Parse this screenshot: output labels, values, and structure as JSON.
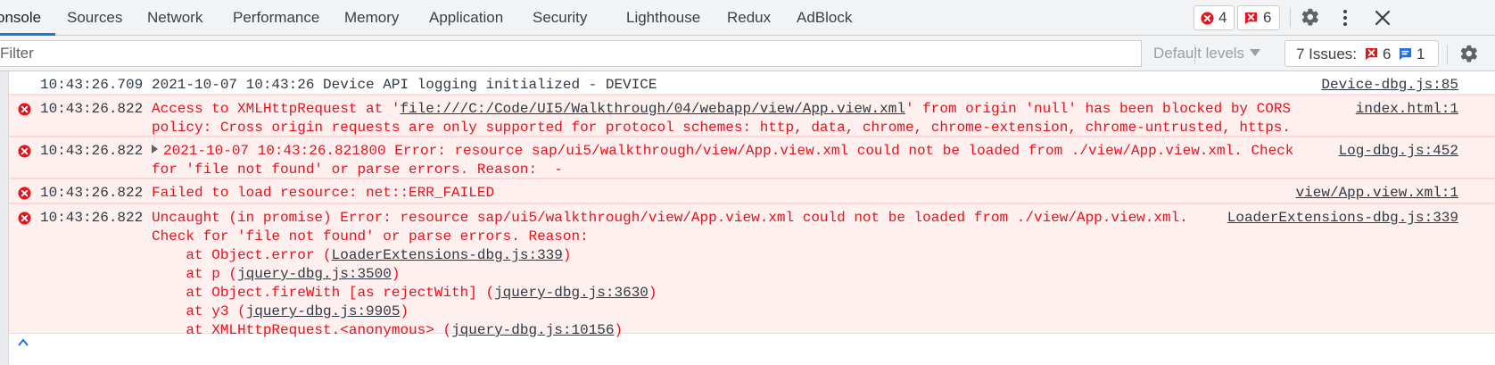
{
  "tabs": [
    {
      "label": "onsole",
      "active": true
    },
    {
      "label": "Sources"
    },
    {
      "label": "Network"
    },
    {
      "label": "Performance"
    },
    {
      "label": "Memory"
    },
    {
      "label": "Application"
    },
    {
      "label": "Security"
    },
    {
      "label": "Lighthouse"
    },
    {
      "label": "Redux"
    },
    {
      "label": "AdBlock"
    }
  ],
  "counters": {
    "errors": "4",
    "warnings": "6"
  },
  "toolbar_icons": [
    "settings-gear-icon",
    "more-vertical-icon",
    "close-icon"
  ],
  "filter": {
    "placeholder": "Filter",
    "value": ""
  },
  "levels_label": "Default levels",
  "issues": {
    "label": "7 Issues:",
    "errors": "6",
    "info": "1"
  },
  "colors": {
    "accent": "#1a73e8",
    "error_red": "#e8121c",
    "error_bg": "#fff0f0"
  },
  "messages": [
    {
      "type": "info",
      "time": "10:43:26.709",
      "text": "2021-10-07 10:43:26 Device API logging initialized - DEVICE",
      "source": "Device-dbg.js:85"
    },
    {
      "type": "error",
      "time": "10:43:26.822",
      "text_pre": "Access to XMLHttpRequest at '",
      "text_link": "file:///C:/Code/UI5/Walkthrough/04/webapp/view/App.view.xml",
      "text_post": "' from origin 'null' has been blocked by CORS",
      "text_line2": "policy: Cross origin requests are only supported for protocol schemes: http, data, chrome, chrome-extension, chrome-untrusted, https.",
      "source": "index.html:1"
    },
    {
      "type": "error",
      "time": "10:43:26.822",
      "text_line1": "2021-10-07 10:43:26.821800 Error: resource sap/ui5/walkthrough/view/App.view.xml could not be loaded from ./view/App.view.xml. Check",
      "text_line2": "for 'file not found' or parse errors. Reason:  -",
      "source": "Log-dbg.js:452"
    },
    {
      "type": "error",
      "time": "10:43:26.822",
      "text": "Failed to load resource: net::ERR_FAILED",
      "source": "view/App.view.xml:1"
    },
    {
      "type": "error",
      "time": "10:43:26.822",
      "text_line1": "Uncaught (in promise) Error: resource sap/ui5/walkthrough/view/App.view.xml could not be loaded from ./view/App.view.xml.",
      "text_line2": "Check for 'file not found' or parse errors. Reason:",
      "stack": [
        {
          "pre": "    at Object.error (",
          "link": "LoaderExtensions-dbg.js:339",
          "post": ")"
        },
        {
          "pre": "    at p (",
          "link": "jquery-dbg.js:3500",
          "post": ")"
        },
        {
          "pre": "    at Object.fireWith [as rejectWith] (",
          "link": "jquery-dbg.js:3630",
          "post": ")"
        },
        {
          "pre": "    at y3 (",
          "link": "jquery-dbg.js:9905",
          "post": ")"
        },
        {
          "pre": "    at XMLHttpRequest.<anonymous> (",
          "link": "jquery-dbg.js:10156",
          "post": ")"
        }
      ],
      "source": "LoaderExtensions-dbg.js:339"
    }
  ]
}
